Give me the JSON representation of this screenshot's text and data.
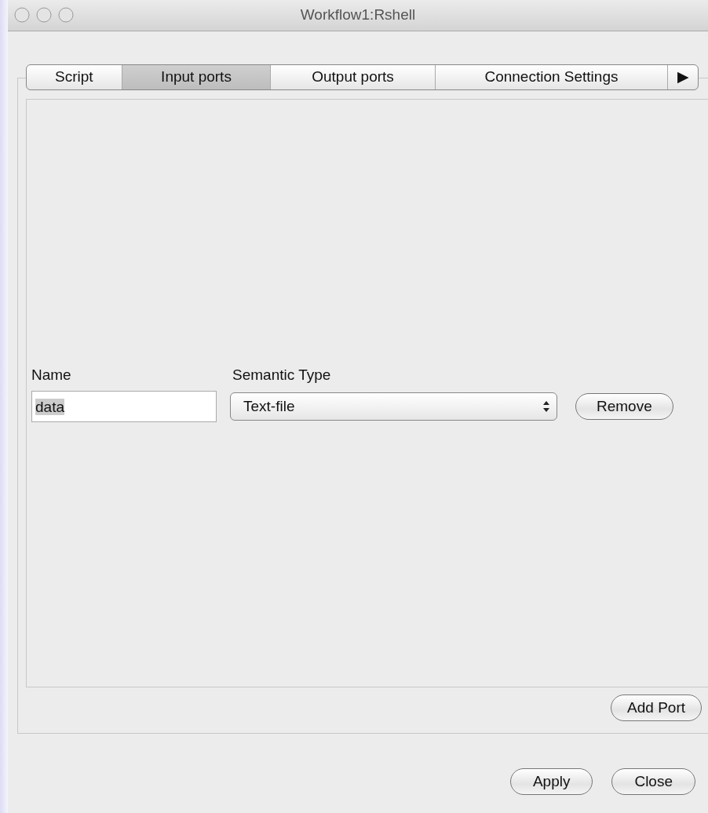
{
  "window": {
    "title": "Workflow1:Rshell"
  },
  "tabs": [
    {
      "label": "Script",
      "selected": false
    },
    {
      "label": "Input ports",
      "selected": true
    },
    {
      "label": "Output ports",
      "selected": false
    },
    {
      "label": "Connection Settings",
      "selected": false
    }
  ],
  "tab_overflow": "▶",
  "ports_table": {
    "columns": [
      "Name",
      "Semantic Type"
    ],
    "rows": [
      {
        "name": "data",
        "name_highlighted": true,
        "semantic_type": "Text-file",
        "remove": "Remove"
      }
    ]
  },
  "add_button": "Add Port",
  "buttons": [
    "Apply",
    "Close"
  ]
}
